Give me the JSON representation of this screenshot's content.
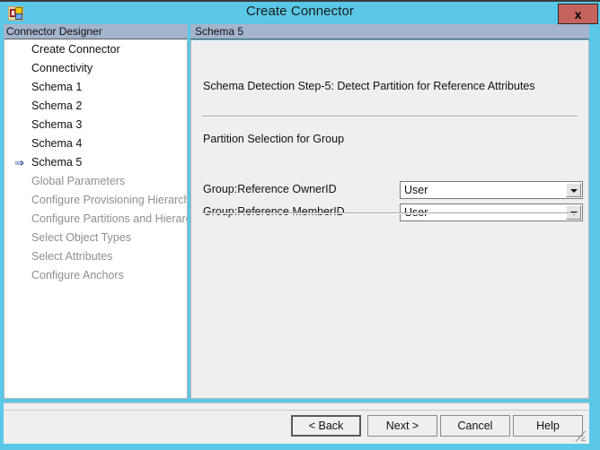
{
  "window": {
    "title": "Create Connector",
    "icon": "connector-icon",
    "close_label": "x"
  },
  "colors": {
    "titlebar": "#5BC8E8",
    "panel_header": "#A3B4CC",
    "close_button": "#c4645c",
    "arrow_marker": "#1b3f8f",
    "content_bg": "#efefef"
  },
  "sidebar": {
    "header": "Connector Designer",
    "items": [
      {
        "label": "Create Connector",
        "state": "done"
      },
      {
        "label": "Connectivity",
        "state": "done"
      },
      {
        "label": "Schema 1",
        "state": "done"
      },
      {
        "label": "Schema 2",
        "state": "done"
      },
      {
        "label": "Schema 3",
        "state": "done"
      },
      {
        "label": "Schema 4",
        "state": "done"
      },
      {
        "label": "Schema 5",
        "state": "current",
        "marker": "arrow-right-icon"
      },
      {
        "label": "Global Parameters",
        "state": "disabled"
      },
      {
        "label": "Configure Provisioning Hierarchy",
        "state": "disabled"
      },
      {
        "label": "Configure Partitions and Hierarchies",
        "state": "disabled"
      },
      {
        "label": "Select Object Types",
        "state": "disabled"
      },
      {
        "label": "Select Attributes",
        "state": "disabled"
      },
      {
        "label": "Configure Anchors",
        "state": "disabled"
      }
    ]
  },
  "content": {
    "header": "Schema 5",
    "step_title": "Schema Detection Step-5: Detect Partition for Reference Attributes",
    "section_label": "Partition Selection for Group",
    "fields": [
      {
        "label": "Group:Reference OwnerID",
        "value": "User",
        "control": "dropdown"
      },
      {
        "label": "Group:Reference MemberID",
        "value": "User",
        "control": "dropdown"
      }
    ]
  },
  "footer": {
    "buttons": [
      {
        "label": "< Back",
        "default": true
      },
      {
        "label": "Next  >",
        "default": false
      },
      {
        "label": "Cancel",
        "default": false
      },
      {
        "label": "Help",
        "default": false
      }
    ]
  }
}
